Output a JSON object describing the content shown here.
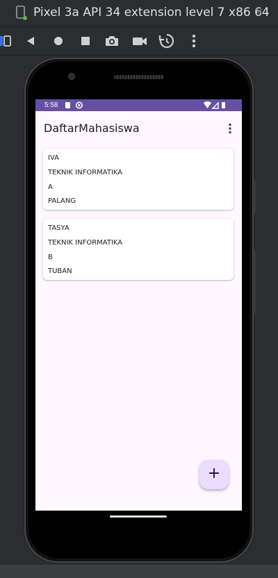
{
  "window": {
    "title": "Pixel 3a API 34 extension level 7 x86 64",
    "close_glyph": "×"
  },
  "toolbar": {
    "icons": [
      "layout-toggle-icon",
      "back-icon",
      "home-icon",
      "overview-icon",
      "camera-icon",
      "video-icon",
      "rotate-icon",
      "more-icon"
    ]
  },
  "status_bar": {
    "time": "5:58",
    "color": "#6750a4"
  },
  "app": {
    "title": "DaftarMahasiswa",
    "background": "#fef7ff"
  },
  "students": [
    {
      "name": "IVA",
      "major": "TEKNIK INFORMATIKA",
      "class": "A",
      "city": "PALANG"
    },
    {
      "name": "TASYA",
      "major": "TEKNIK INFORMATIKA",
      "class": "B",
      "city": "TUBAN"
    }
  ],
  "fab": {
    "label": "+",
    "color": "#eaddff"
  }
}
